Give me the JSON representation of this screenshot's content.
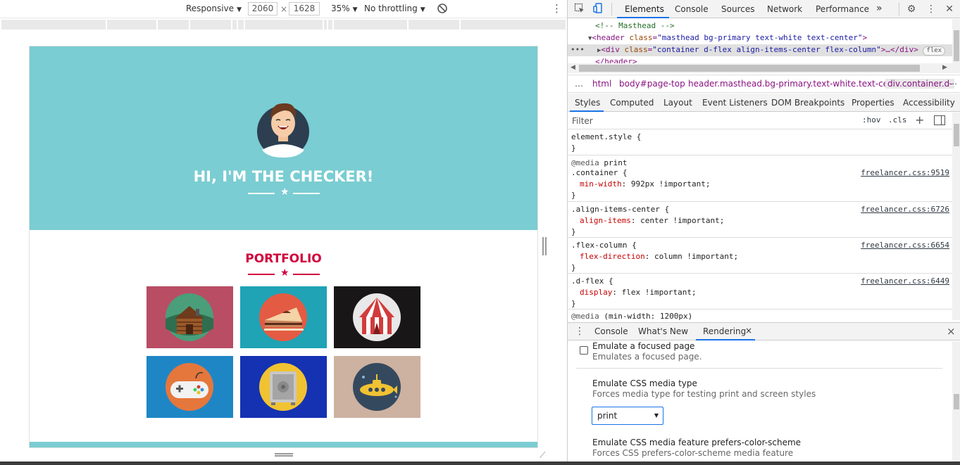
{
  "device_toolbar": {
    "preset": "Responsive",
    "width": "2060",
    "times": "×",
    "height": "1628",
    "zoom": "35%",
    "throttling": "No throttling",
    "rotate_icon": "rotate-icon",
    "more_icon": "kebab-menu-icon"
  },
  "page": {
    "hero_title": "HI, I'M THE CHECKER!",
    "portfolio_title": "PORTFOLIO",
    "colors": {
      "masthead": "#7acdd2",
      "accent": "#d1043e",
      "white": "#ffffff"
    },
    "tiles": [
      {
        "name": "cabin",
        "bg": "#b94d64",
        "icon": "cabin-icon"
      },
      {
        "name": "cake",
        "bg": "#1fa3b5",
        "icon": "cake-icon"
      },
      {
        "name": "circus",
        "bg": "#181616",
        "icon": "circus-tent-icon"
      },
      {
        "name": "game",
        "bg": "#1f86c6",
        "icon": "gamepad-icon"
      },
      {
        "name": "safe",
        "bg": "#1432b2",
        "icon": "safe-icon"
      },
      {
        "name": "submarine",
        "bg": "#cdb1a1",
        "icon": "submarine-icon"
      }
    ]
  },
  "devtools": {
    "tabs": [
      "Elements",
      "Console",
      "Sources",
      "Network",
      "Performance"
    ],
    "active_tab": "Elements",
    "more_tabs": "»",
    "tree": {
      "comment": "<!-- Masthead -->",
      "line2_tag_open": "<header",
      "line2_attr": "class",
      "line2_val": "\"masthead bg-primary text-white text-center\"",
      "line2_close": ">",
      "line3_tag_open": "<div",
      "line3_attr": "class",
      "line3_val": "\"container d-flex align-items-center flex-column\"",
      "line3_close": ">…</div>",
      "line3_badge": "flex",
      "line4": "</header>",
      "dots": "•••"
    },
    "breadcrumbs": [
      "…",
      "html",
      "body#page-top",
      "header.masthead.bg-primary.text-white.text-center",
      "div.container.d-"
    ],
    "breadcrumbs_more": "⋯",
    "sub_tabs": [
      "Styles",
      "Computed",
      "Layout",
      "Event Listeners",
      "DOM Breakpoints",
      "Properties",
      "Accessibility"
    ],
    "active_sub_tab": "Styles",
    "filter_placeholder": "Filter",
    "filter_hov": ":hov",
    "filter_cls": ".cls",
    "styles": {
      "element_style": "element.style {",
      "close": "}",
      "media_print": "@media print",
      "at_media": "@media",
      "print": " print",
      "rule1_sel": ".container {",
      "rule1_prop": "min-width",
      "rule1_val": ": 992px !important;",
      "rule1_src": "freelancer.css:9519",
      "rule2_sel": ".align-items-center {",
      "rule2_prop": "align-items",
      "rule2_val": ": center !important;",
      "rule2_src": "freelancer.css:6726",
      "rule3_sel": ".flex-column {",
      "rule3_prop": "flex-direction",
      "rule3_val": ": column !important;",
      "rule3_src": "freelancer.css:6654",
      "rule4_sel": ".d-flex {",
      "rule4_prop": "display",
      "rule4_val": ": flex !important;",
      "rule4_src": "freelancer.css:6449",
      "media_min": " (min-width: 1200px)"
    },
    "drawer": {
      "tabs": [
        "Console",
        "What's New",
        "Rendering"
      ],
      "active": "Rendering",
      "close_tab": "×",
      "close_drawer": "×"
    },
    "rendering": {
      "focus_title": "Emulate a focused page",
      "focus_sub": "Emulates a focused page.",
      "media_title": "Emulate CSS media type",
      "media_sub": "Forces media type for testing print and screen styles",
      "media_value": "print",
      "scheme_title": "Emulate CSS media feature prefers-color-scheme",
      "scheme_sub": "Forces CSS prefers-color-scheme media feature"
    }
  }
}
